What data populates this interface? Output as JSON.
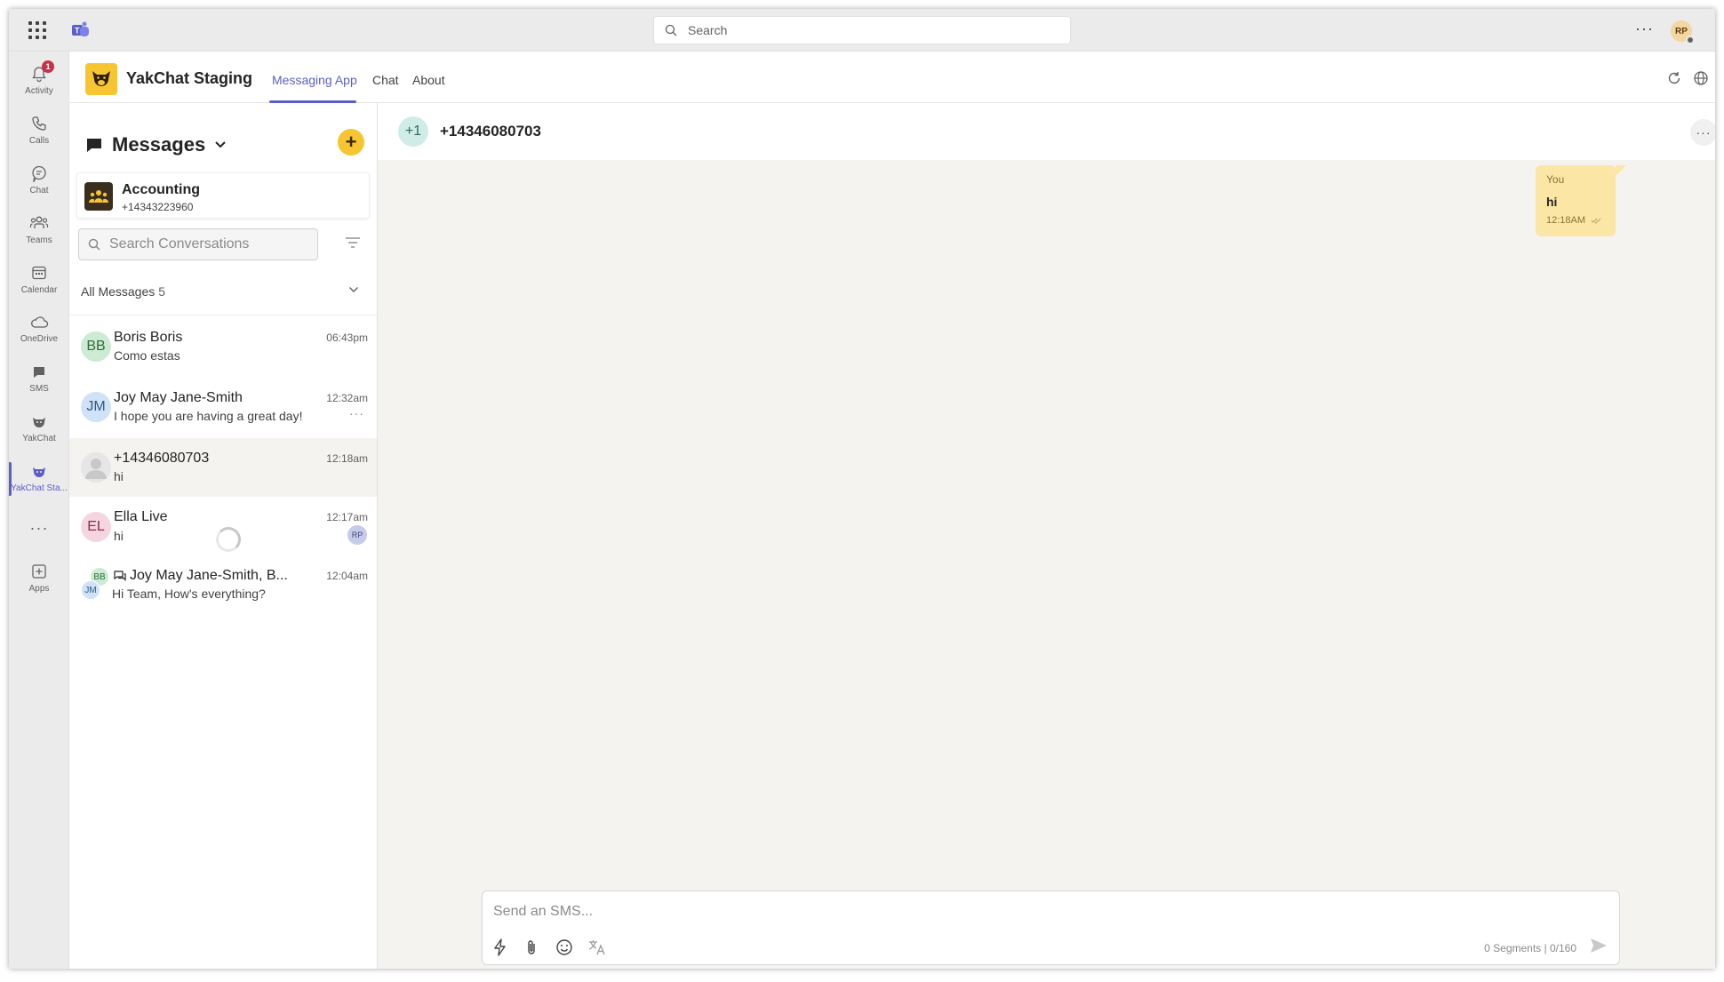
{
  "topbar": {
    "search_placeholder": "Search",
    "user_initials": "RP"
  },
  "rail": {
    "items": [
      {
        "label": "Activity",
        "badge": "1"
      },
      {
        "label": "Calls"
      },
      {
        "label": "Chat"
      },
      {
        "label": "Teams"
      },
      {
        "label": "Calendar"
      },
      {
        "label": "OneDrive"
      },
      {
        "label": "SMS"
      },
      {
        "label": "YakChat"
      },
      {
        "label": "YakChat Sta..."
      },
      {
        "label": "Apps"
      }
    ]
  },
  "app_header": {
    "title": "YakChat Staging",
    "tabs": [
      {
        "label": "Messaging App",
        "active": true
      },
      {
        "label": "Chat"
      },
      {
        "label": "About"
      }
    ]
  },
  "messages_panel": {
    "title": "Messages",
    "account": {
      "name": "Accounting",
      "phone": "+14343223960"
    },
    "search_placeholder": "Search Conversations",
    "section": {
      "label": "All Messages",
      "count": "5"
    },
    "conversations": [
      {
        "initials": "BB",
        "name": "Boris Boris",
        "preview": "Como estas",
        "time": "06:43pm"
      },
      {
        "initials": "JM",
        "name": "Joy May Jane-Smith",
        "preview": "I hope you are having a great day!",
        "time": "12:32am"
      },
      {
        "initials": "",
        "name": "+14346080703",
        "preview": "hi",
        "time": "12:18am",
        "selected": true
      },
      {
        "initials": "EL",
        "name": "Ella Live",
        "preview": "hi",
        "time": "12:17am",
        "assignee": "RP"
      },
      {
        "initials_a": "BB",
        "initials_b": "JM",
        "name": "Joy May Jane-Smith, B...",
        "preview": "Hi Team, How's everything?",
        "time": "12:04am",
        "group": true
      }
    ]
  },
  "chat": {
    "avatar": "+1",
    "title": "+14346080703",
    "messages": [
      {
        "sender": "You",
        "text": "hi",
        "time": "12:18AM"
      }
    ],
    "composer": {
      "placeholder": "Send an SMS...",
      "segments": "0 Segments | 0/160"
    }
  },
  "colors": {
    "accent": "#5b5fc7",
    "brand_yellow": "#f7c531",
    "bubble": "#fbe6a6",
    "badge_red": "#c4314b"
  }
}
